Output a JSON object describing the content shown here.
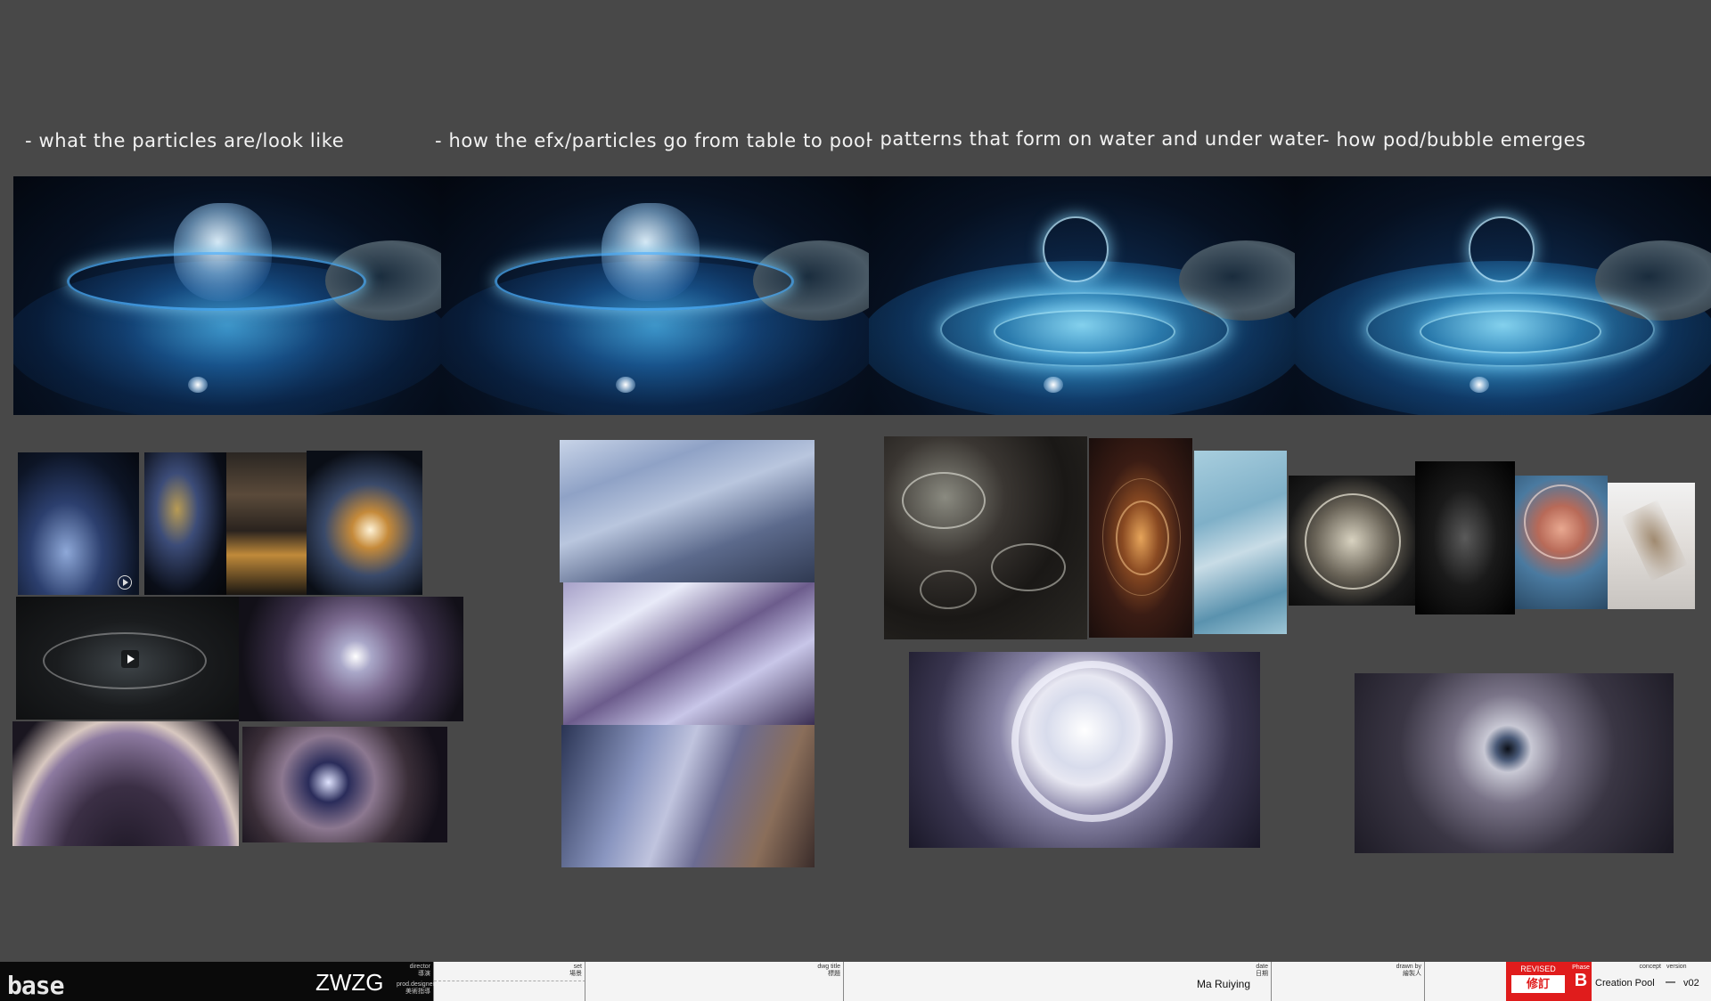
{
  "headings": [
    "- what the particles are/look like",
    "- how the efx/particles go from table to pool",
    "- patterns that form on water and under water",
    "- how pod/bubble emerges"
  ],
  "title_block": {
    "logo": "base",
    "project": "ZWZG",
    "director_label": "director",
    "director_label_cn": "導演",
    "prod_designer_label": "prod.designer",
    "prod_designer_label_cn": "美術指導",
    "set_label": "set",
    "set_label_cn": "場景",
    "dwg_title_label": "dwg title",
    "dwg_title_label_cn": "標題",
    "date_label": "date",
    "date_label_cn": "日期",
    "designer_name": "Ma Ruiying",
    "drawn_by_label": "drawn by",
    "drawn_by_label_cn": "繪製人",
    "revised_label": "REVISED",
    "revised_cn": "修訂",
    "phase_label": "Phase",
    "phase_value": "B",
    "concept_label": "concept",
    "version_label": "version",
    "concept_value": "Creation Pool",
    "separator": "—",
    "version_value": "v02"
  },
  "colors": {
    "background": "#484848",
    "accent_red": "#e01c1c",
    "heading_text": "#f2f2f2"
  },
  "icons": [
    "play-icon"
  ]
}
